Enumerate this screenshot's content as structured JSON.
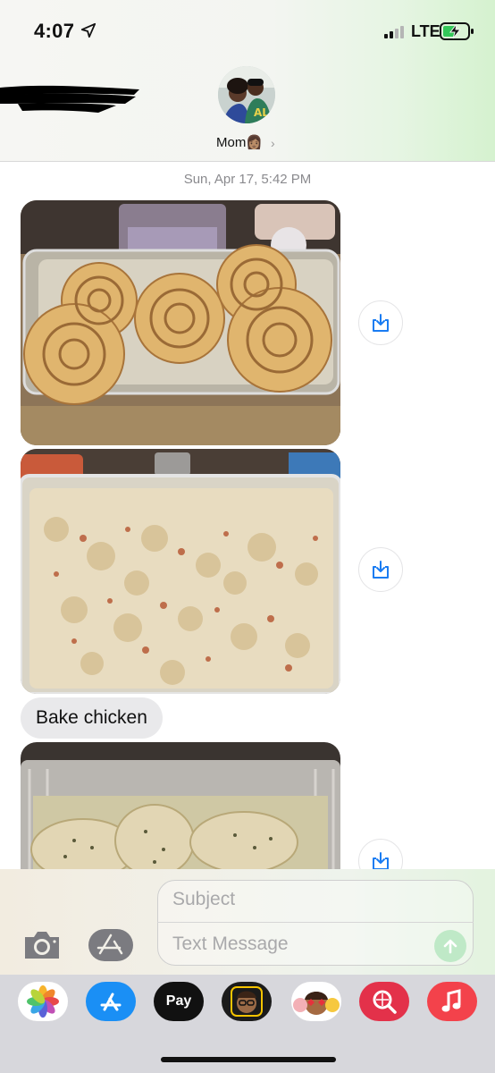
{
  "status_bar": {
    "time": "4:07",
    "network": "LTE"
  },
  "header": {
    "contact_name": "Mom👩🏽",
    "chevron": "›"
  },
  "conversation": {
    "timestamp": "Sun, Apr 17, 5:42 PM",
    "messages": [
      {
        "type": "photo",
        "depicts": "cinnamon rolls in glass baking dish"
      },
      {
        "type": "photo",
        "depicts": "potato salad in plastic container"
      },
      {
        "type": "text",
        "text": "Bake chicken"
      },
      {
        "type": "photo",
        "depicts": "baked chicken in foil pan"
      }
    ]
  },
  "compose": {
    "subject_placeholder": "Subject",
    "message_placeholder": "Text Message"
  },
  "app_drawer": {
    "items": [
      "Photos",
      "App Store",
      "Pay",
      "Memoji Stickers",
      "Memoji",
      "Images",
      "Music"
    ],
    "pay_label": "Pay"
  },
  "icons": {
    "location": "location-arrow-icon",
    "signal": "cellular-signal-icon",
    "battery": "battery-charging-icon",
    "save": "save-download-icon",
    "camera": "camera-icon",
    "apps": "app-store-icon",
    "send": "send-arrow-icon"
  },
  "colors": {
    "accent_blue": "#1a7cf2",
    "send_green": "#bfe9c7",
    "bubble_gray": "#e9e9eb",
    "battery_green": "#34c759",
    "music_red": "#f3424b",
    "images_red": "#e3314a"
  }
}
